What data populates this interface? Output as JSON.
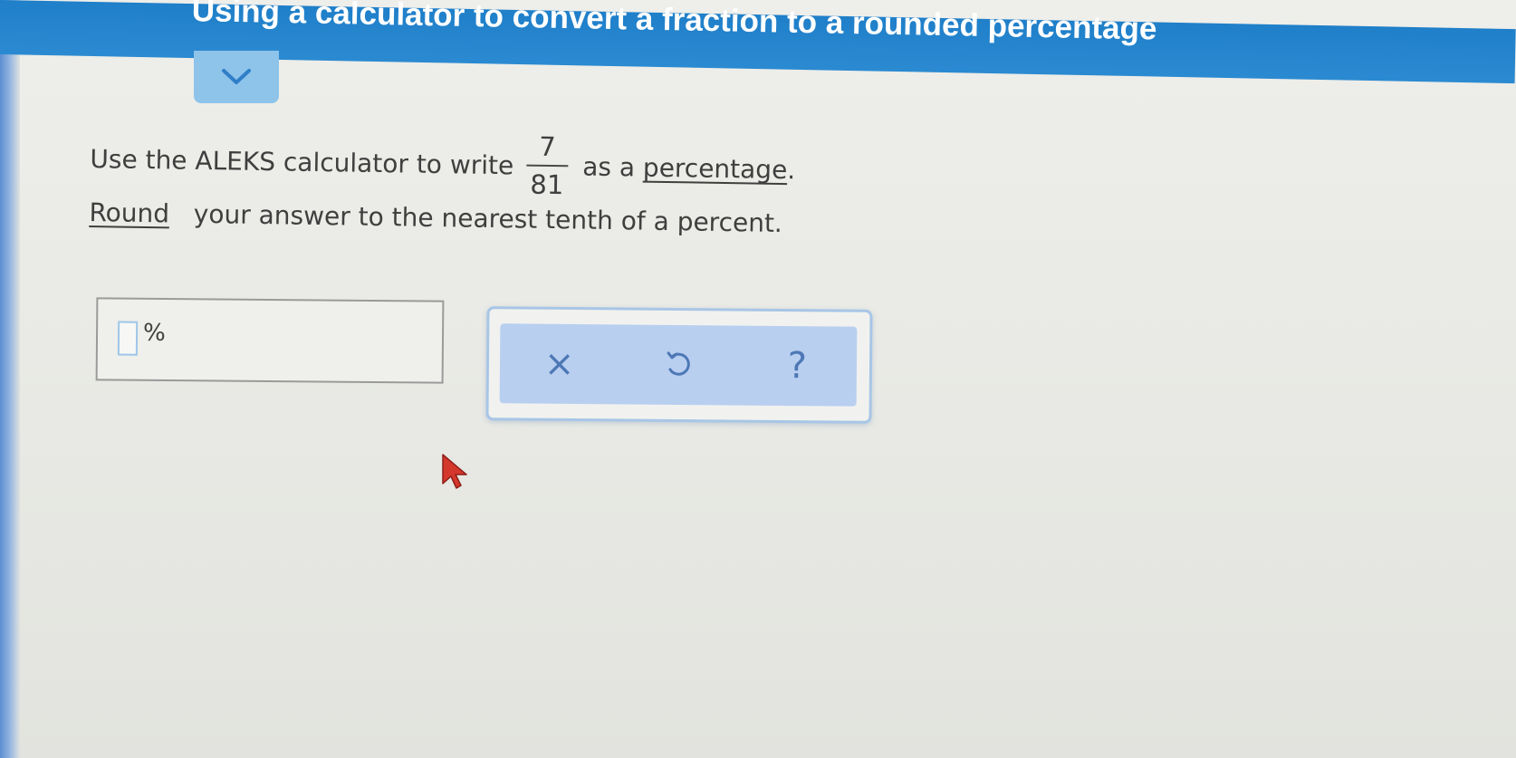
{
  "header": {
    "title": "Using a calculator to convert a fraction to a rounded percentage"
  },
  "question": {
    "prefix": "Use the ALEKS calculator to write",
    "fraction": {
      "numerator": "7",
      "denominator": "81"
    },
    "middle": "as a",
    "link_percentage": "percentage",
    "period": ".",
    "link_round": "Round",
    "line2_rest": "your answer to the nearest tenth of a percent."
  },
  "answer": {
    "value": "",
    "unit": "%"
  },
  "tools": {
    "clear_label": "×",
    "undo_icon": "undo-icon",
    "help_label": "?"
  },
  "colors": {
    "header_blue": "#2b8ad1",
    "tab_blue": "#8ec3ea",
    "tools_fill": "#b9cff0",
    "tool_glyph": "#4d78b5",
    "cursor_red": "#d4372c"
  }
}
